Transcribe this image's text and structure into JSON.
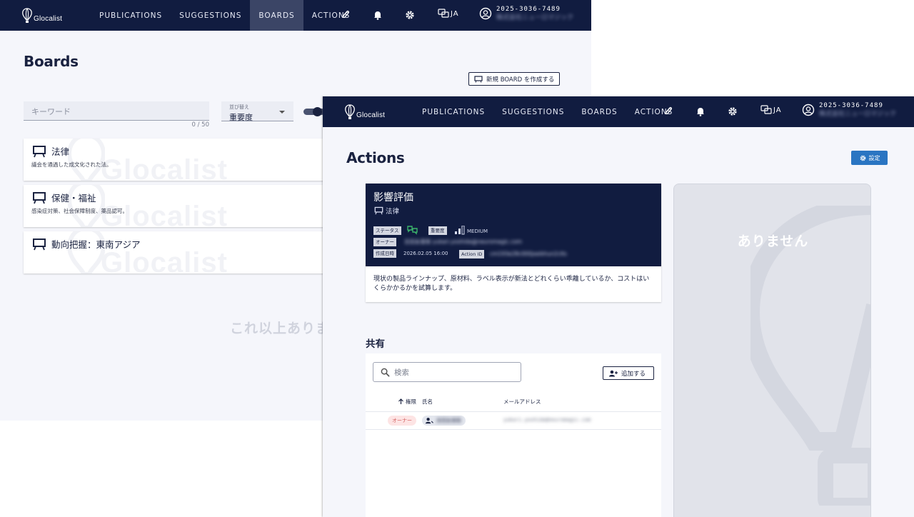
{
  "nav": {
    "brand": "Glocalist",
    "menu": [
      "PUBLICATIONS",
      "SUGGESTIONS",
      "BOARDS",
      "ACTIONS"
    ],
    "lang": "JA",
    "account_number": "2025-3036-7489",
    "account_name": "株式会社ニューロマジック"
  },
  "boards_page": {
    "title": "Boards",
    "new_board_label": "新規 BOARD を作成する",
    "keyword_placeholder": "キーワード",
    "keyword_count": "0 / 50",
    "sort_label": "並び替え",
    "sort_value": "重要度",
    "watermark": "Glocalist",
    "boards": [
      {
        "name": "法律",
        "description": "議会を通過した成文化された法。"
      },
      {
        "name": "保健・福祉",
        "description": "感染症対策、社会保障制度、薬品認可。"
      },
      {
        "name": "動向把握：東南アジア",
        "description": ""
      }
    ],
    "no_more": "これ以上ありません"
  },
  "actions_page": {
    "title": "Actions",
    "settings_label": "設定",
    "action": {
      "title": "影響評価",
      "board": "法律",
      "status_label": "ステータス",
      "importance_label": "重要度",
      "importance_value": "MEDIUM",
      "owner_label": "オーナー",
      "owner_value": "吉田友香梨 yukari.yoshida@neuromagic.com",
      "created_label": "作成日時",
      "created_value": "2026.02.05 16:00",
      "action_id_label": "Action ID",
      "action_id_value": "cm193e28c000jxeikhun2clts",
      "body": "現状の製品ラインナップ、原材料、ラベル表示が新法とどれくらい乖離しているか、コストはいくらかかるかを試算します。"
    },
    "side_empty": "ありません",
    "share": {
      "heading": "共有",
      "search_placeholder": "検索",
      "add_label": "追加する",
      "columns": [
        "権限",
        "氏名",
        "メールアドレス"
      ],
      "rows": [
        {
          "role": "オーナー",
          "name": "吉田友香梨",
          "email": "yukari.yoshida@neuromagic.com"
        }
      ]
    }
  },
  "colors": {
    "navy": "#111c40",
    "accent_blue": "#2a75c2",
    "status_green": "#3bb36b"
  }
}
